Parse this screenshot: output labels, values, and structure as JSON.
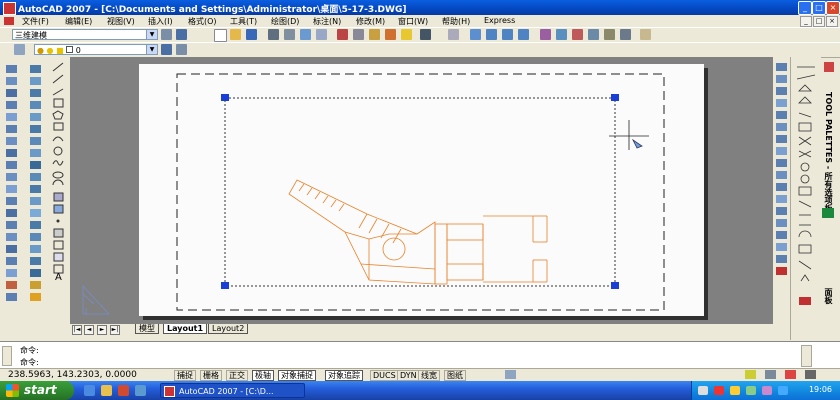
{
  "window": {
    "title": "AutoCAD 2007 - [C:\\Documents and Settings\\Administrator\\桌面\\5-17-3.DWG]",
    "controls": [
      "_",
      "□",
      "×"
    ]
  },
  "menu": {
    "items": [
      "文件(F)",
      "编辑(E)",
      "视图(V)",
      "插入(I)",
      "格式(O)",
      "工具(T)",
      "绘图(D)",
      "标注(N)",
      "修改(M)",
      "窗口(W)",
      "帮助(H)",
      "Express"
    ],
    "doc_controls": [
      "_",
      "□",
      "×"
    ]
  },
  "toolbar": {
    "workspace_select": "三维建模",
    "layer_select": "0"
  },
  "layout_tabs": {
    "nav": [
      "|◄",
      "◄",
      "►",
      "►|"
    ],
    "tabs": [
      "模型",
      "Layout1",
      "Layout2"
    ],
    "active": "Layout1"
  },
  "tool_palettes": {
    "title": "TOOL PALETTES - 所有选项板",
    "tab": "面板"
  },
  "command": {
    "lines": [
      "命令:",
      "命令:"
    ]
  },
  "status": {
    "coords": "238.5963, 143.2303, 0.0000",
    "toggles": [
      {
        "label": "捕捉",
        "on": false
      },
      {
        "label": "栅格",
        "on": false
      },
      {
        "label": "正交",
        "on": false
      },
      {
        "label": "极轴",
        "on": true
      },
      {
        "label": "对象捕捉",
        "on": true
      },
      {
        "label": "对象追踪",
        "on": true
      },
      {
        "label": "DUCS",
        "on": false
      },
      {
        "label": "DYN",
        "on": false
      },
      {
        "label": "线宽",
        "on": false
      },
      {
        "label": "图纸",
        "on": false
      }
    ]
  },
  "taskbar": {
    "start_label": "start",
    "app_label": "AutoCAD 2007 - [C:\\D...",
    "clock": "19:06"
  },
  "colors": {
    "drawing": "#e8822a",
    "grip": "#1a3fd6",
    "workspace_bg": "#808080"
  }
}
